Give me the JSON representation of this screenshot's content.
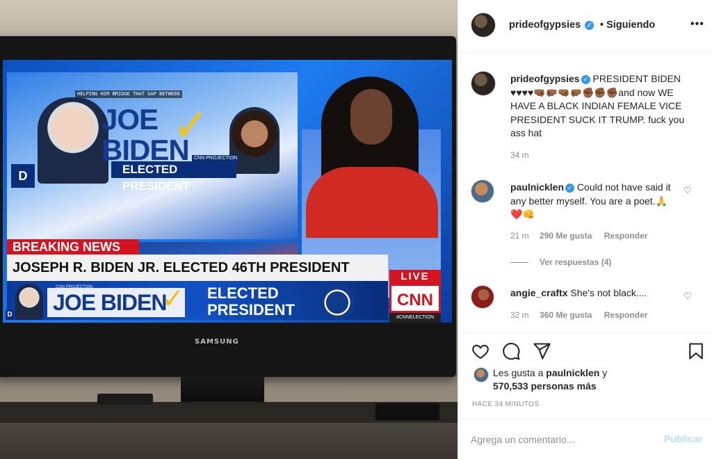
{
  "photo": {
    "tv_brand": "SAMSUNG",
    "screen": {
      "helping_text": "HELPING HIM BRIDGE THAT GAP BETWEEN",
      "name_line1": "JOE",
      "name_line2": "BIDEN",
      "cnn_projection": "CNN PROJECTION",
      "elected_president": "ELECTED PRESIDENT",
      "d_badge": "D",
      "breaking_news": "BREAKING NEWS",
      "headline": "JOSEPH R. BIDEN JR. ELECTED 46TH PRESIDENT",
      "lower_projection": "CNN PROJECTION",
      "lower_name": "JOE BIDEN",
      "lower_elected": "ELECTED PRESIDENT",
      "live": "LIVE",
      "cnn_logo": "CNN",
      "hashtag": "#CNNELECTION"
    }
  },
  "post": {
    "author": "prideofgypsies",
    "follow_status": "• Siguiendo",
    "more_icon": "more-options-icon",
    "caption": {
      "username": "prideofgypsies",
      "text": "PRESIDENT BIDEN ♥♥♥♥🤜🏾🤛🏾🤜🏾🤛🏾✊🏾✊🏾✊🏾and now WE HAVE A BLACK INDIAN FEMALE VICE PRESIDENT SUCK IT TRUMP. fuck you ass hat",
      "time": "34 m"
    },
    "comments": [
      {
        "username": "paulnicklen",
        "verified": true,
        "text": "Could not have said it any better myself. You are a poet.🙏❤️👊",
        "time": "21 m",
        "likes": "290 Me gusta",
        "reply": "Responder",
        "view_replies": "Ver respuestas (4)"
      },
      {
        "username": "angie_craftx",
        "verified": false,
        "text": "She's not black....",
        "time": "32 m",
        "likes": "360 Me gusta",
        "reply": "Responder"
      }
    ],
    "likes_prefix": "Les gusta a",
    "likes_user": "paulnicklen",
    "likes_suffix": "y",
    "likes_count": "570,533 personas más",
    "time_ago": "HACE 34 MINUTOS",
    "comment_placeholder": "Agrega un comentario...",
    "publish_label": "Publicar",
    "colors": {
      "link_blue": "#3897f0",
      "publish_disabled": "#b2dffc",
      "secondary_text": "#8e8e8e",
      "text": "#262626"
    }
  }
}
